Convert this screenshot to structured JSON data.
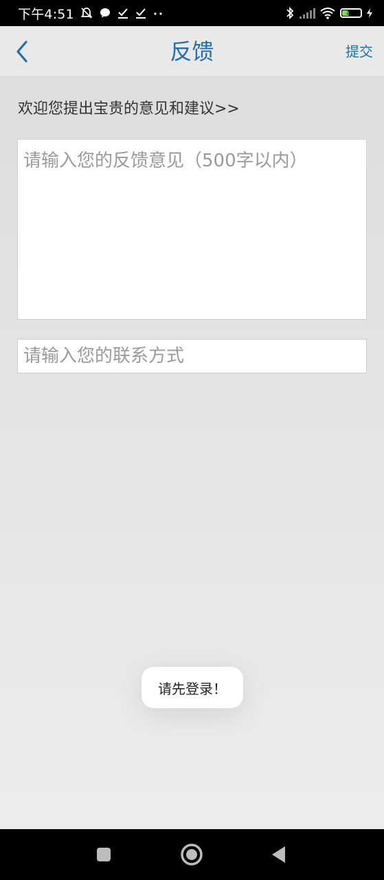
{
  "status_bar": {
    "time": "下午4:51",
    "icons_left": [
      "alarm-off-icon",
      "chat-bubble-icon",
      "check-download-icon",
      "check-download-icon",
      "more-dots-icon"
    ],
    "icons_right": [
      "bluetooth-icon",
      "signal-icon",
      "wifi-icon",
      "battery-icon",
      "charging-icon"
    ],
    "battery_level": "36",
    "battery_fill_fraction": 0.36,
    "battery_color": "#7ed957"
  },
  "header": {
    "back_icon": "chevron-left-icon",
    "title": "反馈",
    "submit_label": "提交",
    "accent_color": "#1f6fae"
  },
  "main": {
    "intro": "欢迎您提出宝贵的意见和建议>>",
    "feedback": {
      "value": "",
      "placeholder": "请输入您的反馈意见（500字以内）"
    },
    "contact": {
      "value": "",
      "placeholder": "请输入您的联系方式"
    }
  },
  "toast": {
    "message": "请先登录！"
  },
  "nav_bar": {
    "buttons": [
      "recents-square-icon",
      "home-circle-icon",
      "back-triangle-icon"
    ]
  }
}
